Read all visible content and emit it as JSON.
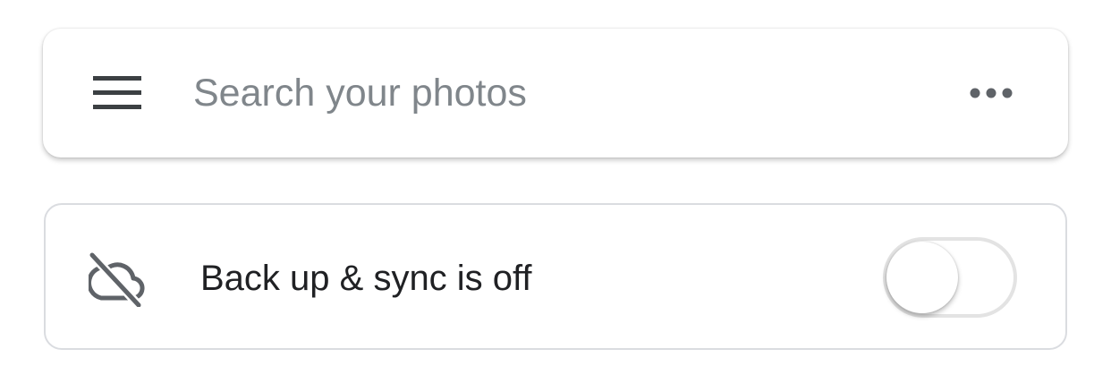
{
  "search": {
    "placeholder": "Search your photos",
    "value": "",
    "menu_icon": "hamburger-menu-icon",
    "more_icon": "more-horizontal-icon"
  },
  "backup": {
    "label": "Back up & sync is off",
    "icon": "cloud-off-icon",
    "toggle_on": false
  },
  "colors": {
    "placeholder_text": "#80868b",
    "primary_text": "#202124",
    "icon": "#5f6368",
    "card_border": "#dadce0",
    "toggle_track": "#e3e3e3",
    "background": "#ffffff"
  }
}
